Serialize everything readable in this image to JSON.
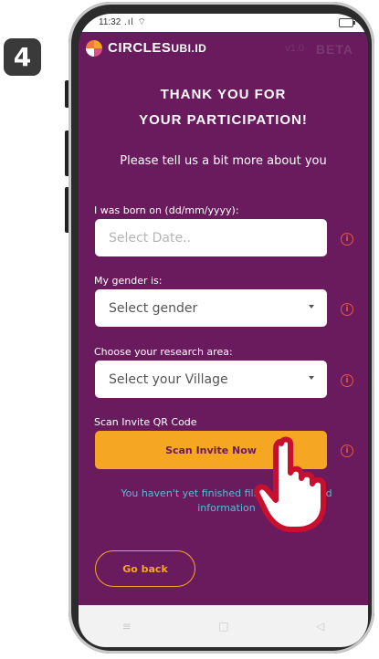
{
  "step_number": "4",
  "status_bar": {
    "time": "11:32",
    "signal": ".ıl ⌔"
  },
  "header": {
    "brand": "CIRCLES",
    "brand_suffix": "UBI.ID",
    "beta_label": "BETA",
    "beta_prefix": "v1.0"
  },
  "title_line1": "THANK YOU FOR",
  "title_line2": "YOUR PARTICIPATION!",
  "subtitle": "Please tell us a bit more about you",
  "form": {
    "birth_label": "I was born on (dd/mm/yyyy):",
    "birth_placeholder": "Select Date..",
    "gender_label": "My gender is:",
    "gender_value": "Select gender",
    "research_label": "Choose your research area:",
    "research_value": "Select your Village",
    "qr_label": "Scan Invite QR Code",
    "scan_button": "Scan Invite Now",
    "info_glyph": "i"
  },
  "warning_text": "You haven't yet finished filling all required information",
  "back_button": "Go back",
  "nav": {
    "menu_glyph": "≡",
    "home_glyph": "□",
    "back_glyph": "◁"
  },
  "colors": {
    "background": "#6a1b5e",
    "accent": "#f5a623",
    "info_icon": "#e8573f",
    "warning_text": "#5fb8d4"
  },
  "icons": [
    "step-badge",
    "signal-icon",
    "wifi-icon",
    "battery-icon",
    "logo-icon",
    "info-icon",
    "caret-down-icon",
    "pointing-hand-icon"
  ]
}
